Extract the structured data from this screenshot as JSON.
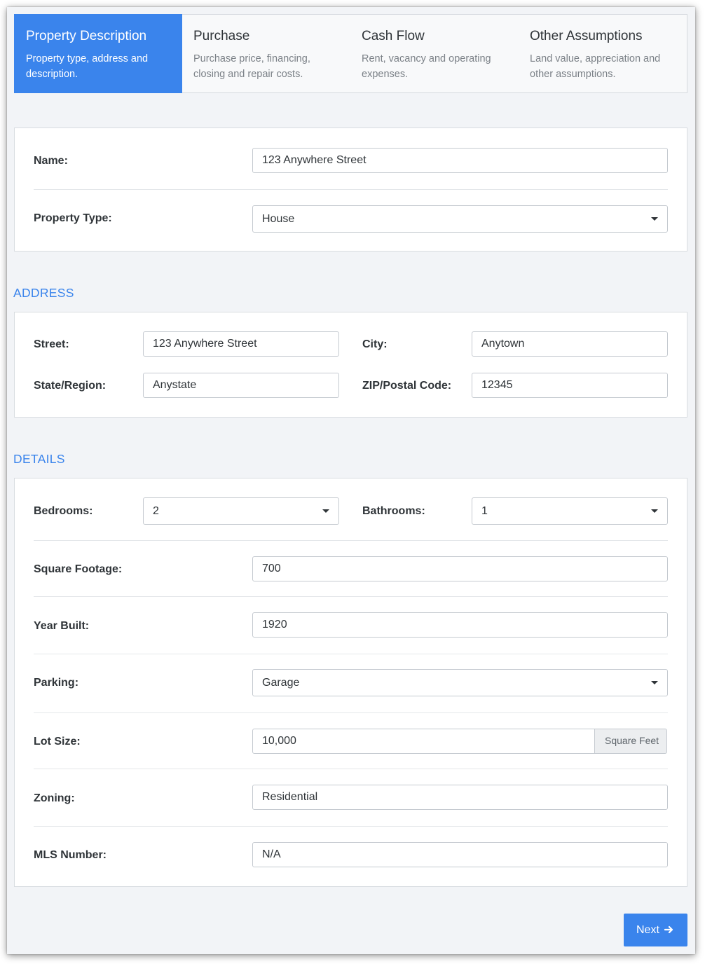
{
  "steps": [
    {
      "title": "Property Description",
      "desc": "Property type, address and description."
    },
    {
      "title": "Purchase",
      "desc": "Purchase price, financing, closing and repair costs."
    },
    {
      "title": "Cash Flow",
      "desc": "Rent, vacancy and operating expenses."
    },
    {
      "title": "Other Assumptions",
      "desc": "Land value, appreciation and other assumptions."
    }
  ],
  "general": {
    "name_label": "Name:",
    "name_value": "123 Anywhere Street",
    "type_label": "Property Type:",
    "type_value": "House"
  },
  "address": {
    "heading": "ADDRESS",
    "street_label": "Street:",
    "street_value": "123 Anywhere Street",
    "city_label": "City:",
    "city_value": "Anytown",
    "state_label": "State/Region:",
    "state_value": "Anystate",
    "zip_label": "ZIP/Postal Code:",
    "zip_value": "12345"
  },
  "details": {
    "heading": "DETAILS",
    "bedrooms_label": "Bedrooms:",
    "bedrooms_value": "2",
    "bathrooms_label": "Bathrooms:",
    "bathrooms_value": "1",
    "sqft_label": "Square Footage:",
    "sqft_value": "700",
    "year_label": "Year Built:",
    "year_value": "1920",
    "parking_label": "Parking:",
    "parking_value": "Garage",
    "lot_label": "Lot Size:",
    "lot_value": "10,000",
    "lot_unit": "Square Feet",
    "zoning_label": "Zoning:",
    "zoning_value": "Residential",
    "mls_label": "MLS Number:",
    "mls_value": "N/A"
  },
  "footer": {
    "next_label": "Next",
    "next_icon": "arrow-right-icon"
  },
  "colors": {
    "accent": "#3a84ec",
    "background": "#f2f4f7"
  }
}
